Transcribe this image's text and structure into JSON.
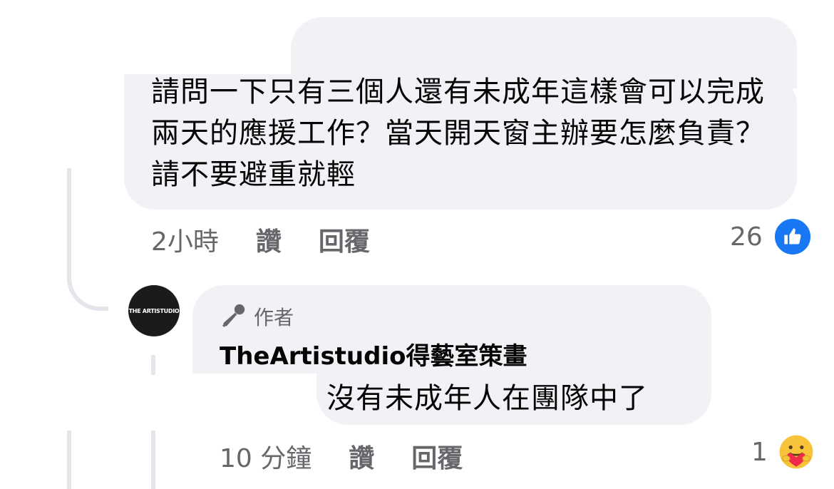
{
  "comment": {
    "text": "請問一下只有三個人還有未成年這樣會可以完成兩天的應援工作？當天開天窗主辦要怎麼負責？請不要避重就輕",
    "time": "2小時",
    "like_label": "讚",
    "reply_label": "回覆",
    "reaction_count": "26",
    "reaction_icon": "like-icon"
  },
  "reply": {
    "avatar_text": "THE ARTISTUDIO",
    "author_badge_icon": "microphone-icon",
    "author_badge": "作者",
    "author_name": "TheArtistudio得藝室策畫",
    "text": "沒有未成年人在團隊中了",
    "time": "10 分鐘",
    "like_label": "讚",
    "reply_label": "回覆",
    "reaction_count": "1",
    "reaction_icon": "care-icon"
  },
  "colors": {
    "bubble": "#f0f2f5",
    "meta_text": "#65676b",
    "like_blue": "#1877f2",
    "thread_line": "#e4e6eb"
  }
}
